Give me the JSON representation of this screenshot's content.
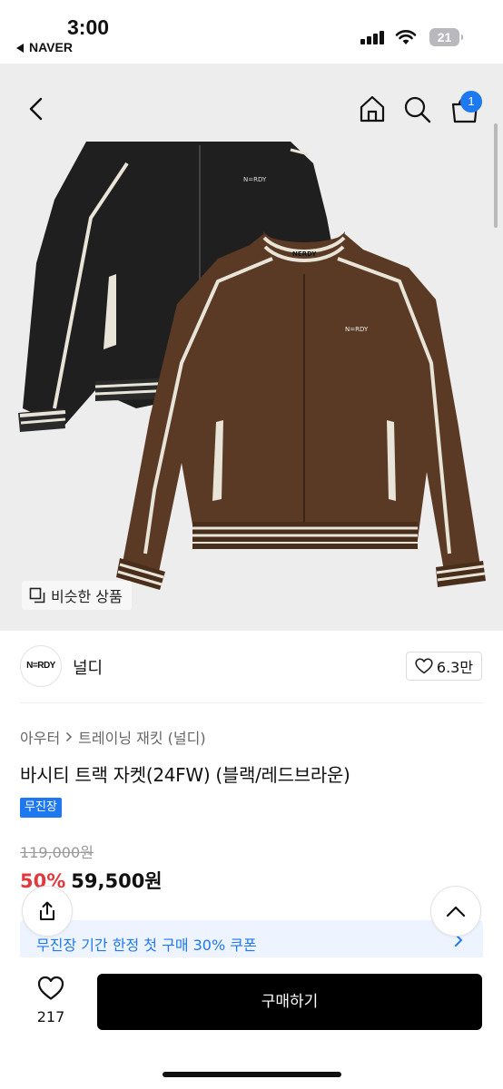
{
  "status_bar": {
    "time": "3:00",
    "back_app": "NAVER",
    "battery": "21"
  },
  "hero": {
    "similar_label": "비슷한 상품",
    "cart_count": "1",
    "jacket_logo": "N=RDY",
    "jacket_collar_logo": "NERDY"
  },
  "brand": {
    "logo_text": "N=RDY",
    "name": "널디",
    "likes": "6.3만"
  },
  "breadcrumb": {
    "level1": "아우터",
    "level2": "트레이닝 재킷 (널디)"
  },
  "product": {
    "title": "바시티 트랙 자켓(24FW) (블랙/레드브라운)",
    "tag": "무진장",
    "original_price": "119,000원",
    "discount": "50%",
    "sale_price": "59,500원"
  },
  "coupon": {
    "text": "무진장 기간 한정 첫 구매 30% 쿠폰"
  },
  "bottom": {
    "wish_count": "217",
    "buy_label": "구매하기"
  },
  "colors": {
    "accent": "#1e78f0",
    "discount": "#e03a3e",
    "jacket_black": "#1f1f1f",
    "jacket_brown": "#5a3a24",
    "trim": "#e8e4d8"
  }
}
